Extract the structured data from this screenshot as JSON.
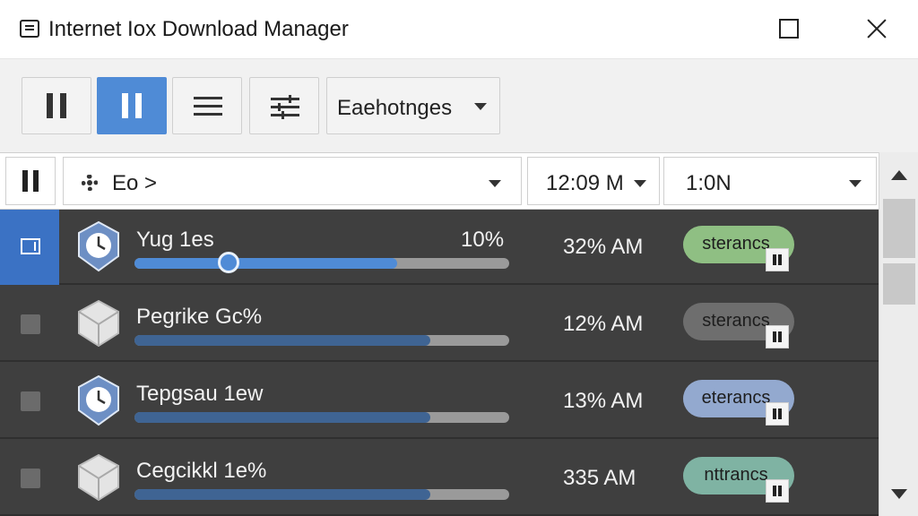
{
  "window": {
    "title": "Internet Iox Download Manager",
    "controls": {
      "maximize_icon": "square-icon",
      "close_icon": "close-icon"
    }
  },
  "toolbar": {
    "buttons": [
      {
        "icon": "pause-icon",
        "active": false
      },
      {
        "icon": "pause-icon",
        "active": true
      },
      {
        "icon": "list-icon",
        "active": false
      },
      {
        "icon": "sliders-icon",
        "active": false
      }
    ],
    "dropdown_label": "Eaehotnges"
  },
  "filter": {
    "category_label": "Eo >",
    "time_value": "12:09 M",
    "range_value": "1:0N"
  },
  "downloads": [
    {
      "name": "Yug 1es",
      "percent_label": "10%",
      "time": "32% AM",
      "status": "sterancs",
      "status_color": "#8fbf83",
      "icon": "clock-file-icon",
      "progress": 0.7,
      "selected": true
    },
    {
      "name": "Pegrike Gc%",
      "time": "12% AM",
      "status": "sterancs",
      "status_color": "#6e6e6e",
      "icon": "box-file-icon",
      "progress": 0.79,
      "selected": false
    },
    {
      "name": "Tepgsau 1ew",
      "time": "13% AM",
      "status": "eterancs",
      "status_color": "#93a9cf",
      "icon": "clock-file-icon",
      "progress": 0.79,
      "selected": false
    },
    {
      "name": "Cegcikkl 1e%",
      "time": "335 AM",
      "status": "nttrancs",
      "status_color": "#7fb3a3",
      "icon": "box-file-icon",
      "progress": 0.79,
      "selected": false
    }
  ],
  "colors": {
    "accent": "#4f8bd6",
    "list_background": "#3f3f3f",
    "progress_fill": "#3f6493"
  }
}
